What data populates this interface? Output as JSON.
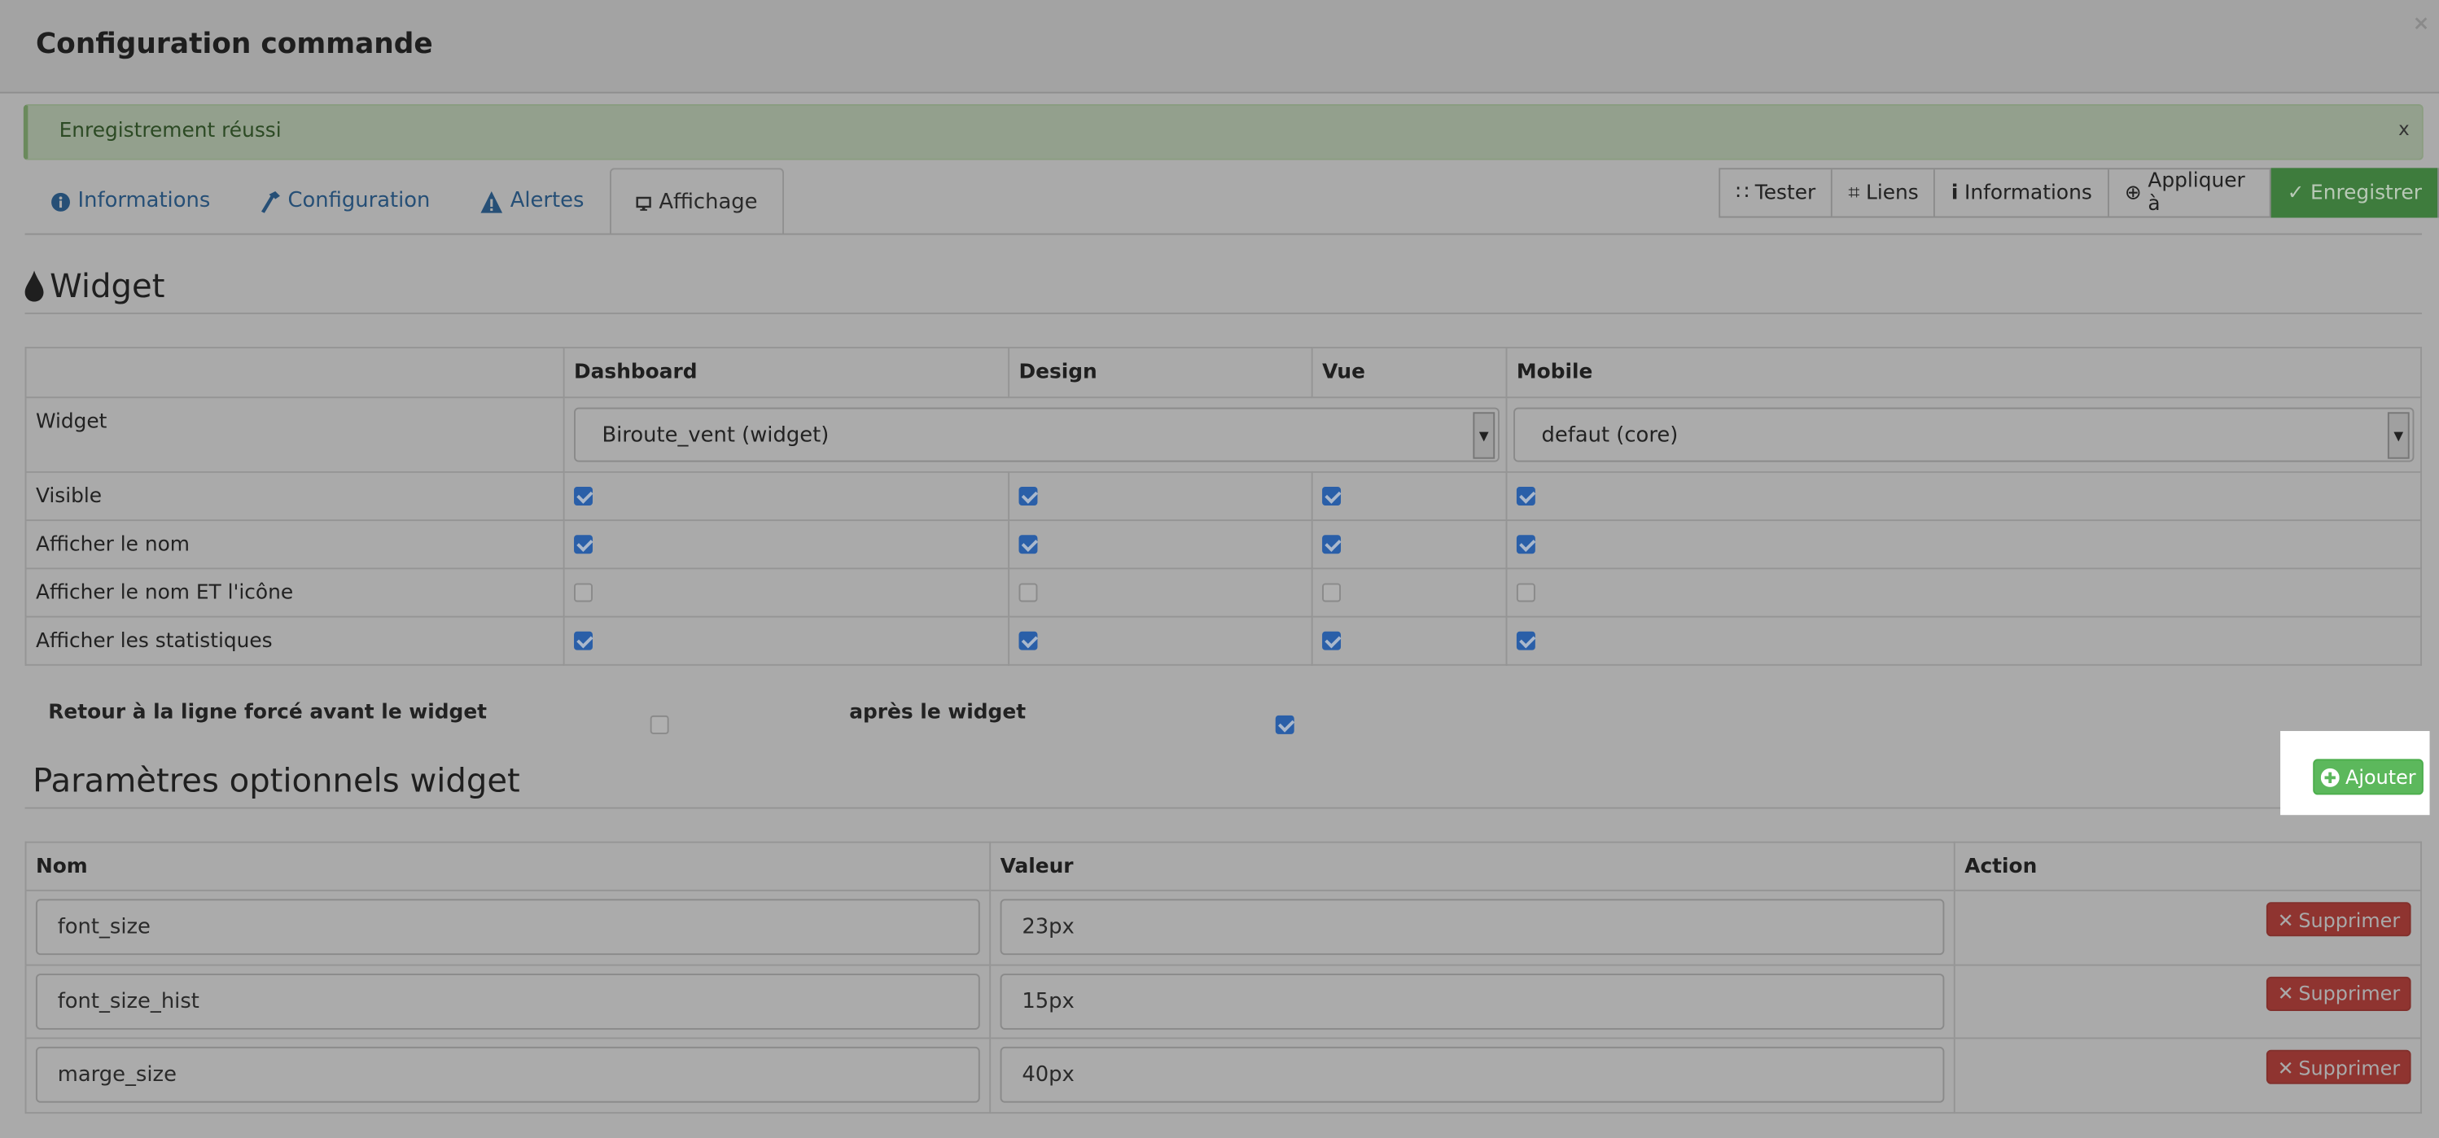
{
  "modal": {
    "title": "Configuration commande",
    "close": "×"
  },
  "alert": {
    "text": "Enregistrement réussi",
    "close": "x"
  },
  "tabs": [
    {
      "label": "Informations",
      "icon": "info-circle-icon"
    },
    {
      "label": "Configuration",
      "icon": "wrench-icon"
    },
    {
      "label": "Alertes",
      "icon": "warning-icon"
    },
    {
      "label": "Affichage",
      "icon": "desktop-icon",
      "active": true
    }
  ],
  "actions": {
    "tester": "Tester",
    "liens": "Liens",
    "informations": "Informations",
    "appliquer": "Appliquer à",
    "enregistrer": "Enregistrer"
  },
  "widget": {
    "heading": "Widget",
    "columns": [
      "",
      "Dashboard",
      "Design",
      "Vue",
      "Mobile"
    ],
    "widget_row_label": "Widget",
    "dashboard_select": "Biroute_vent (widget)",
    "mobile_select": "defaut (core)",
    "rows": [
      {
        "label": "Visible",
        "checks": [
          true,
          true,
          true,
          true
        ]
      },
      {
        "label": "Afficher le nom",
        "checks": [
          true,
          true,
          true,
          true
        ]
      },
      {
        "label": "Afficher le nom ET l'icône",
        "checks": [
          false,
          false,
          false,
          false
        ]
      },
      {
        "label": "Afficher les statistiques",
        "checks": [
          true,
          true,
          true,
          true
        ]
      }
    ],
    "line_before_label": "Retour à la ligne forcé avant le widget",
    "line_before": false,
    "line_after_label": "après le widget",
    "line_after": true
  },
  "params": {
    "heading": "Paramètres optionnels widget",
    "add_label": "Ajouter",
    "columns": [
      "Nom",
      "Valeur",
      "Action"
    ],
    "delete_label": "Supprimer",
    "rows": [
      {
        "name": "font_size",
        "value": "23px"
      },
      {
        "name": "font_size_hist",
        "value": "15px"
      },
      {
        "name": "marge_size",
        "value": "40px"
      }
    ]
  },
  "colors": {
    "success": "#5cb85c",
    "danger": "#d9534f",
    "primary": "#337ab7"
  }
}
